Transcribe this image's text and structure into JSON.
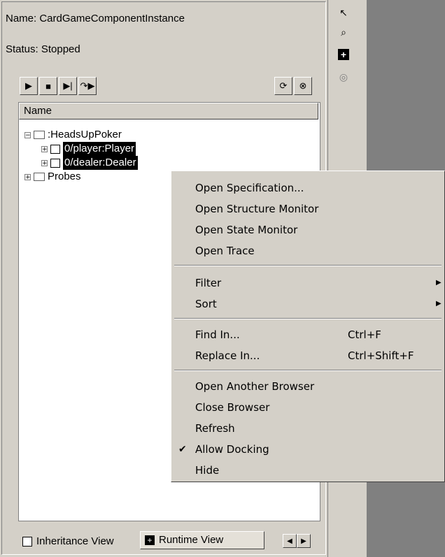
{
  "info": {
    "name_text": "Name:  CardGameComponentInstance",
    "status_text": "Status:  Stopped"
  },
  "toolbar": {
    "icons": [
      "play-icon",
      "stop-icon",
      "step-icon",
      "step-over-icon",
      "refresh-icon",
      "close-icon"
    ]
  },
  "tree": {
    "header": "Name",
    "root": ":HeadsUpPoker",
    "child1": "0/player:Player",
    "child2": "0/dealer:Dealer",
    "probes": "Probes"
  },
  "tabs": {
    "tab1": "Inheritance View",
    "tab2": "Runtime View"
  },
  "menu": {
    "open_spec": "Open Specification...",
    "open_structure": "Open Structure Monitor",
    "open_state": "Open State Monitor",
    "open_trace": "Open Trace",
    "filter": "Filter",
    "sort": "Sort",
    "find_in": "Find In...",
    "find_shortcut": "Ctrl+F",
    "replace_in": "Replace In...",
    "replace_shortcut": "Ctrl+Shift+F",
    "open_browser": "Open Another Browser",
    "close_browser": "Close Browser",
    "refresh": "Refresh",
    "allow_docking": "Allow Docking",
    "hide": "Hide"
  }
}
